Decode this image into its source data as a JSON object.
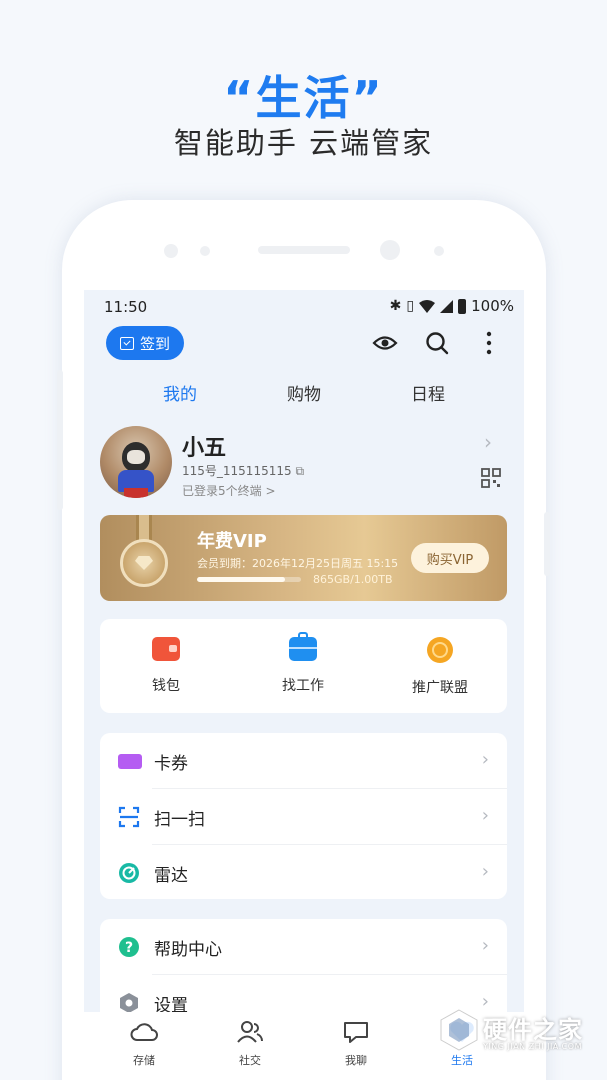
{
  "promo": {
    "headline": "“生活”",
    "subline": "智能助手 云端管家"
  },
  "status_bar": {
    "time": "11:50",
    "battery": "100%",
    "icons": [
      "bluetooth-icon",
      "vibrate-icon",
      "wifi-icon",
      "signal-icon",
      "battery-icon"
    ]
  },
  "topbar": {
    "signin_label": "签到",
    "icons": [
      "eye-icon",
      "search-icon",
      "more-vertical-icon"
    ]
  },
  "tabs": [
    {
      "label": "我的",
      "active": true
    },
    {
      "label": "购物",
      "active": false
    },
    {
      "label": "日程",
      "active": false
    }
  ],
  "profile": {
    "name": "小五",
    "account_id": "115号_115115115",
    "login_status": "已登录5个终端 >"
  },
  "vip": {
    "title": "年费VIP",
    "expiry": "会员到期：2026年12月25日周五 15:15",
    "storage_used": "865GB/1.00TB",
    "storage_fraction": 0.845,
    "buy_button": "购买VIP",
    "colors": {
      "gold_light": "#e6c994",
      "gold_dark": "#b18e5e"
    }
  },
  "quick_actions": [
    {
      "label": "钱包",
      "icon": "wallet-icon",
      "color": "#f0553a"
    },
    {
      "label": "找工作",
      "icon": "briefcase-icon",
      "color": "#1f8ff0"
    },
    {
      "label": "推广联盟",
      "icon": "coins-icon",
      "color": "#f5a623"
    }
  ],
  "menu1": [
    {
      "label": "卡券",
      "icon": "ticket-icon"
    },
    {
      "label": "扫一扫",
      "icon": "scan-icon"
    },
    {
      "label": "雷达",
      "icon": "radar-icon"
    }
  ],
  "menu2": [
    {
      "label": "帮助中心",
      "icon": "help-icon"
    },
    {
      "label": "设置",
      "icon": "settings-icon"
    }
  ],
  "bottom_nav": [
    {
      "label": "存储",
      "icon": "cloud-icon",
      "active": false
    },
    {
      "label": "社交",
      "icon": "users-icon",
      "active": false
    },
    {
      "label": "我聊",
      "icon": "chat-icon",
      "active": false
    },
    {
      "label": "生活",
      "icon": "life-icon",
      "active": true
    }
  ],
  "watermark": {
    "title": "硬件之家",
    "subtitle": "YING JIAN ZHI JIA.COM"
  },
  "accent_color": "#1d78ef"
}
